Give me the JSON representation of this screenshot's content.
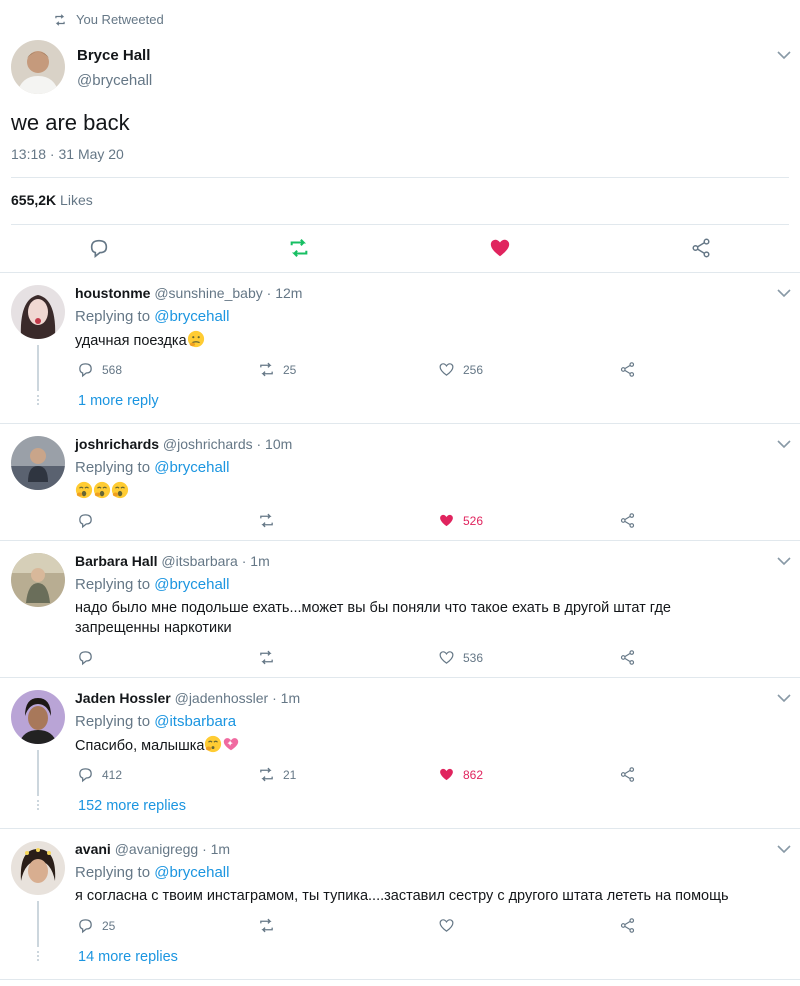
{
  "main_tweet": {
    "retweet_label": "You Retweeted",
    "author_name": "Bryce Hall",
    "author_handle": "@brycehall",
    "text": "we are back",
    "timestamp": "13:18 · 31 May 20",
    "likes_count": "655,2K",
    "likes_label": "Likes",
    "icons": [
      "retweet-icon",
      "reply-icon",
      "retweet-icon",
      "heart-filled-icon",
      "share-icon",
      "chevron-down-icon"
    ],
    "colors": {
      "retweet": "#17bf63",
      "like": "#e0245e",
      "link": "#1b95e0",
      "muted": "#657786"
    }
  },
  "replies": [
    {
      "name": "houstonme",
      "handle": "@sunshine_baby",
      "time": "· 12m",
      "replying_label": "Replying to",
      "replying_to": "@brycehall",
      "text": "удачная поездка",
      "emojis": [
        "thinking-face-emoji"
      ],
      "reply_count": "568",
      "retweet_count": "25",
      "like_count": "256",
      "liked": false,
      "more_replies": "1 more reply"
    },
    {
      "name": "joshrichards",
      "handle": "@joshrichards",
      "time": "· 10m",
      "replying_label": "Replying to",
      "replying_to": "@brycehall",
      "text": "",
      "emojis": [
        "yawning-face-emoji",
        "yawning-face-emoji",
        "yawning-face-emoji"
      ],
      "reply_count": "",
      "retweet_count": "",
      "like_count": "526",
      "liked": true,
      "more_replies": ""
    },
    {
      "name": "Barbara Hall",
      "handle": "@itsbarbara",
      "time": "· 1m",
      "replying_label": "Replying to",
      "replying_to": "@brycehall",
      "text": "надо было мне подольше ехать...может вы бы поняли что такое ехать в другой штат где запрещенны наркотики",
      "emojis": [],
      "reply_count": "",
      "retweet_count": "",
      "like_count": "536",
      "liked": false,
      "more_replies": ""
    },
    {
      "name": "Jaden Hossler",
      "handle": "@jadenhossler",
      "time": "· 1m",
      "replying_label": "Replying to",
      "replying_to": "@itsbarbara",
      "text": "Спасибо, малышка",
      "emojis": [
        "kissing-face-emoji",
        "sparkling-heart-emoji"
      ],
      "reply_count": "412",
      "retweet_count": "21",
      "like_count": "862",
      "liked": true,
      "more_replies": "152 more replies"
    },
    {
      "name": "avani",
      "handle": "@avanigregg",
      "time": "· 1m",
      "replying_label": "Replying to",
      "replying_to": "@brycehall",
      "text": "я согласна с твоим инстаграмом, ты тупика....заставил сестру с другого штата лететь на помощь",
      "emojis": [],
      "reply_count": "25",
      "retweet_count": "",
      "like_count": "",
      "liked": false,
      "more_replies": "14 more replies"
    }
  ]
}
